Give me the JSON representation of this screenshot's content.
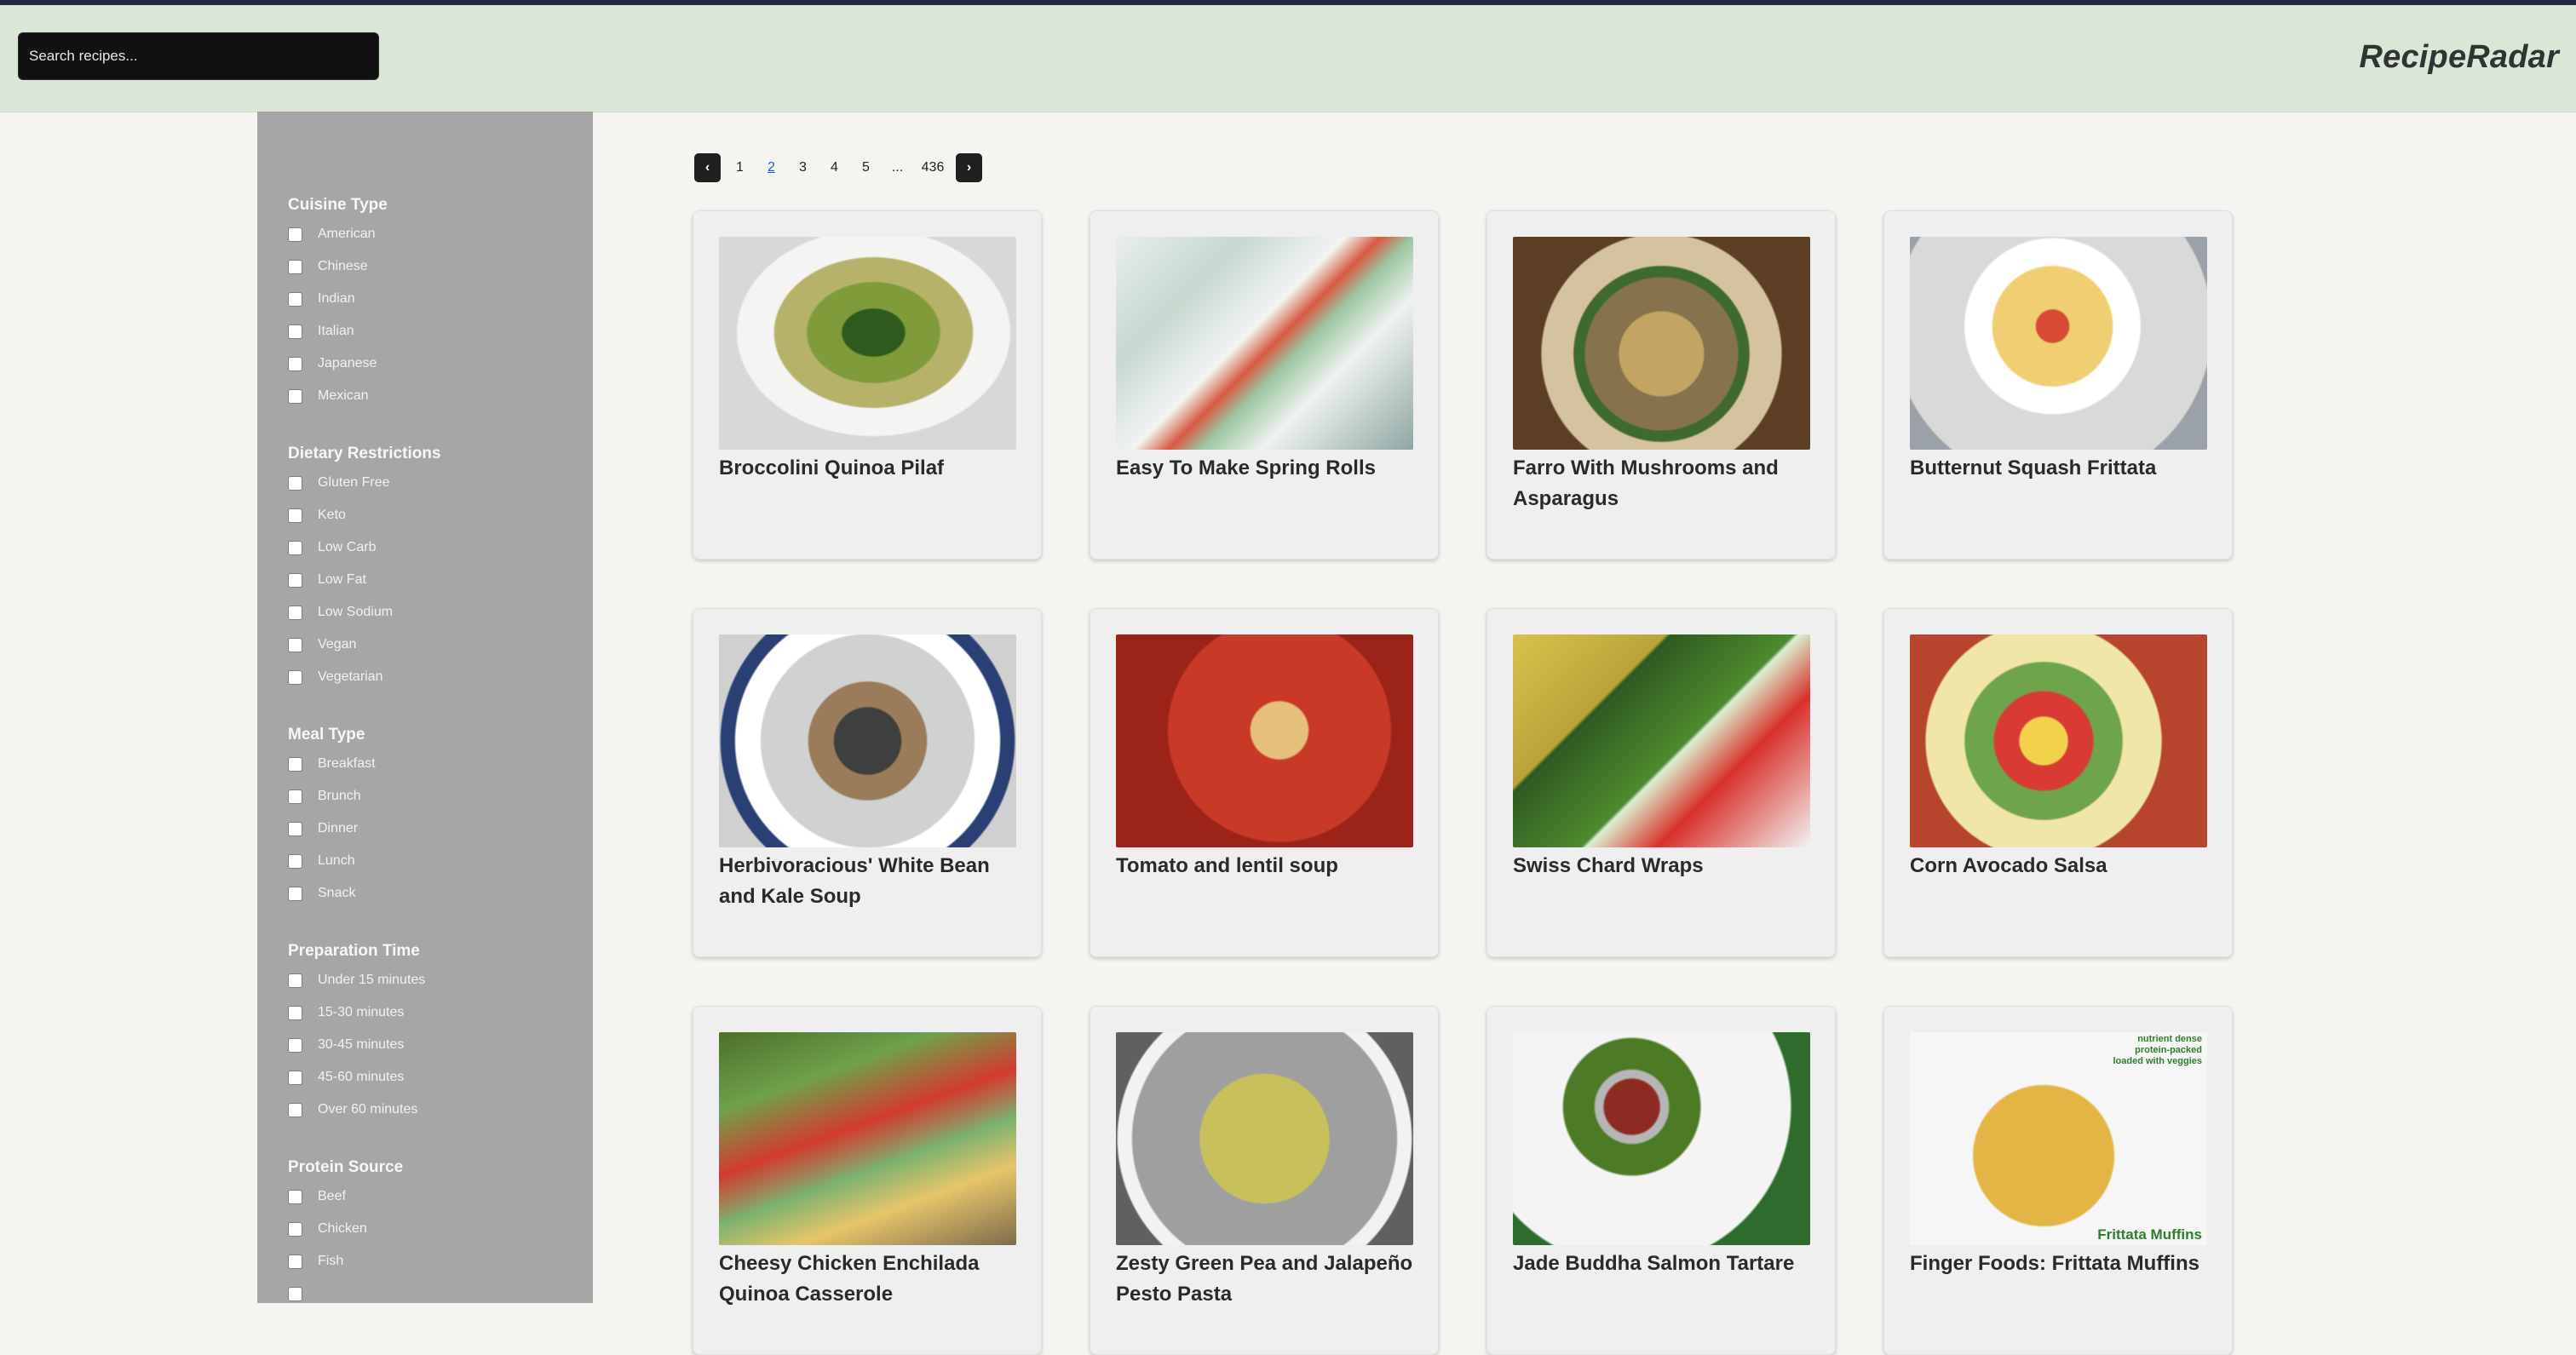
{
  "header": {
    "search_placeholder": "Search recipes...",
    "brand": "RecipeRadar"
  },
  "sidebar": {
    "groups": [
      {
        "title": "Cuisine Type",
        "options": [
          "American",
          "Chinese",
          "Indian",
          "Italian",
          "Japanese",
          "Mexican"
        ]
      },
      {
        "title": "Dietary Restrictions",
        "options": [
          "Gluten Free",
          "Keto",
          "Low Carb",
          "Low Fat",
          "Low Sodium",
          "Vegan",
          "Vegetarian"
        ]
      },
      {
        "title": "Meal Type",
        "options": [
          "Breakfast",
          "Brunch",
          "Dinner",
          "Lunch",
          "Snack"
        ]
      },
      {
        "title": "Preparation Time",
        "options": [
          "Under 15 minutes",
          "15-30 minutes",
          "30-45 minutes",
          "45-60 minutes",
          "Over 60 minutes"
        ]
      },
      {
        "title": "Protein Source",
        "options": [
          "Beef",
          "Chicken",
          "Fish"
        ]
      }
    ]
  },
  "pagination": {
    "prev": "‹",
    "next": "›",
    "pages": [
      "1",
      "2",
      "3",
      "4",
      "5",
      "...",
      "436"
    ],
    "current": "2"
  },
  "recipes": [
    {
      "title": "Broccolini Quinoa Pilaf"
    },
    {
      "title": "Easy To Make Spring Rolls"
    },
    {
      "title": "Farro With Mushrooms and Asparagus"
    },
    {
      "title": "Butternut Squash Frittata"
    },
    {
      "title": "Herbivoracious' White Bean and Kale Soup"
    },
    {
      "title": "Tomato and lentil soup"
    },
    {
      "title": "Swiss Chard Wraps"
    },
    {
      "title": "Corn Avocado Salsa"
    },
    {
      "title": "Cheesy Chicken Enchilada Quinoa Casserole"
    },
    {
      "title": "Zesty Green Pea and Jalapeño Pesto Pasta"
    },
    {
      "title": "Jade Buddha Salmon Tartare"
    },
    {
      "title": "Finger Foods: Frittata Muffins"
    }
  ],
  "photo_captions": {
    "frittata_muffins_badge": "nutrient dense\nprotein-packed\nloaded with veggies",
    "frittata_muffins_label": "Frittata Muffins"
  }
}
